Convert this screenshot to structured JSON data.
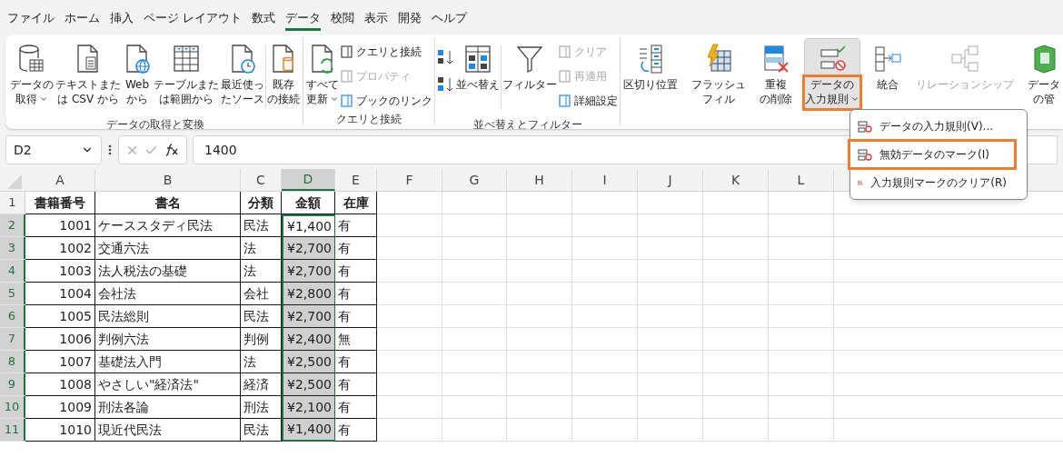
{
  "menu_tabs": [
    {
      "label": "ファイル",
      "selected": false
    },
    {
      "label": "ホーム",
      "selected": false
    },
    {
      "label": "挿入",
      "selected": false
    },
    {
      "label": "ページ レイアウト",
      "selected": false
    },
    {
      "label": "数式",
      "selected": false
    },
    {
      "label": "データ",
      "selected": true
    },
    {
      "label": "校閲",
      "selected": false
    },
    {
      "label": "表示",
      "selected": false
    },
    {
      "label": "開発",
      "selected": false
    },
    {
      "label": "ヘルプ",
      "selected": false
    }
  ],
  "ribbon": {
    "groups": [
      {
        "title": "データの取得と変換",
        "items": [
          {
            "kind": "large",
            "lines": [
              "データの",
              "取得"
            ],
            "dropdown": true
          },
          {
            "kind": "large",
            "lines": [
              "テキストまた",
              "は CSV から"
            ]
          },
          {
            "kind": "large",
            "lines": [
              "Web",
              "から"
            ]
          },
          {
            "kind": "large",
            "lines": [
              "テーブルまた",
              "は範囲から"
            ]
          },
          {
            "kind": "large",
            "lines": [
              "最近使っ",
              "たソース"
            ]
          },
          {
            "kind": "separator"
          },
          {
            "kind": "large",
            "lines": [
              "既存",
              "の接続"
            ]
          }
        ]
      },
      {
        "title": "クエリと接続",
        "items": [
          {
            "kind": "large",
            "lines": [
              "すべて",
              "更新"
            ],
            "dropdown": true
          },
          {
            "kind": "stack",
            "entries": [
              {
                "label": "クエリと接続",
                "disabled": false
              },
              {
                "label": "プロパティ",
                "disabled": true
              },
              {
                "label": "ブックのリンク",
                "disabled": false
              }
            ]
          }
        ]
      },
      {
        "title": "並べ替えとフィルター",
        "items": [
          {
            "kind": "sort"
          },
          {
            "kind": "large",
            "lines": [
              "並べ替え"
            ]
          },
          {
            "kind": "separator"
          },
          {
            "kind": "large",
            "lines": [
              "フィルター"
            ]
          },
          {
            "kind": "stack",
            "entries": [
              {
                "label": "クリア",
                "disabled": true
              },
              {
                "label": "再適用",
                "disabled": true
              },
              {
                "label": "詳細設定",
                "disabled": false
              }
            ]
          }
        ]
      },
      {
        "items": [
          {
            "kind": "large",
            "lines": [
              "区切り位置"
            ]
          },
          {
            "kind": "large",
            "lines": [
              "フラッシュ",
              "フィル"
            ]
          },
          {
            "kind": "large",
            "lines": [
              "重複",
              "の削除"
            ]
          },
          {
            "kind": "large",
            "lines": [
              "データの",
              "入力規則"
            ],
            "dropdown": true,
            "pressed": true,
            "highlighted": true
          },
          {
            "kind": "large",
            "lines": [
              "統合"
            ]
          },
          {
            "kind": "large",
            "lines": [
              "リレーションシップ"
            ],
            "disabled": true
          },
          {
            "kind": "large",
            "lines": [
              "データ",
              "の管"
            ]
          }
        ]
      }
    ]
  },
  "name_box": "D2",
  "formula": "1400",
  "columns": [
    {
      "letter": "A",
      "selected": false
    },
    {
      "letter": "B",
      "selected": false
    },
    {
      "letter": "C",
      "selected": false
    },
    {
      "letter": "D",
      "selected": true
    },
    {
      "letter": "E",
      "selected": false
    },
    {
      "letter": "F",
      "selected": false
    },
    {
      "letter": "G",
      "selected": false
    },
    {
      "letter": "H",
      "selected": false
    },
    {
      "letter": "I",
      "selected": false
    },
    {
      "letter": "J",
      "selected": false
    },
    {
      "letter": "K",
      "selected": false
    },
    {
      "letter": "L",
      "selected": false
    }
  ],
  "rows": [
    {
      "number": "1",
      "selected": false,
      "cells": [
        "書籍番号",
        "書名",
        "分類",
        "金額",
        "在庫"
      ]
    },
    {
      "number": "2",
      "selected": true,
      "cells": [
        "1001",
        "ケーススタディ民法",
        "民法",
        "¥1,400",
        "有"
      ]
    },
    {
      "number": "3",
      "selected": true,
      "cells": [
        "1002",
        "交通六法",
        "法",
        "¥2,700",
        "有"
      ]
    },
    {
      "number": "4",
      "selected": true,
      "cells": [
        "1003",
        "法人税法の基礎",
        "法",
        "¥2,700",
        "有"
      ]
    },
    {
      "number": "5",
      "selected": true,
      "cells": [
        "1004",
        "会社法",
        "会社",
        "¥2,800",
        "有"
      ]
    },
    {
      "number": "6",
      "selected": true,
      "cells": [
        "1005",
        "民法総則",
        "民法",
        "¥2,700",
        "有"
      ]
    },
    {
      "number": "7",
      "selected": true,
      "cells": [
        "1006",
        "判例六法",
        "判例",
        "¥2,400",
        "無"
      ]
    },
    {
      "number": "8",
      "selected": true,
      "cells": [
        "1007",
        "基礎法入門",
        "法",
        "¥2,500",
        "有"
      ]
    },
    {
      "number": "9",
      "selected": true,
      "cells": [
        "1008",
        "やさしい\"経済法\"",
        "経済",
        "¥2,500",
        "有"
      ]
    },
    {
      "number": "10",
      "selected": true,
      "cells": [
        "1009",
        "刑法各論",
        "刑法",
        "¥2,100",
        "有"
      ]
    },
    {
      "number": "11",
      "selected": true,
      "cells": [
        "1010",
        "現近代民法",
        "民法",
        "¥1,400",
        "有"
      ]
    }
  ],
  "dropdown_menu": {
    "items": [
      {
        "label": "データの入力規則(V)...",
        "highlighted": false
      },
      {
        "label": "無効データのマーク(I)",
        "highlighted": true
      },
      {
        "label": "入力規則マークのクリア(R)",
        "highlighted": false
      }
    ]
  }
}
